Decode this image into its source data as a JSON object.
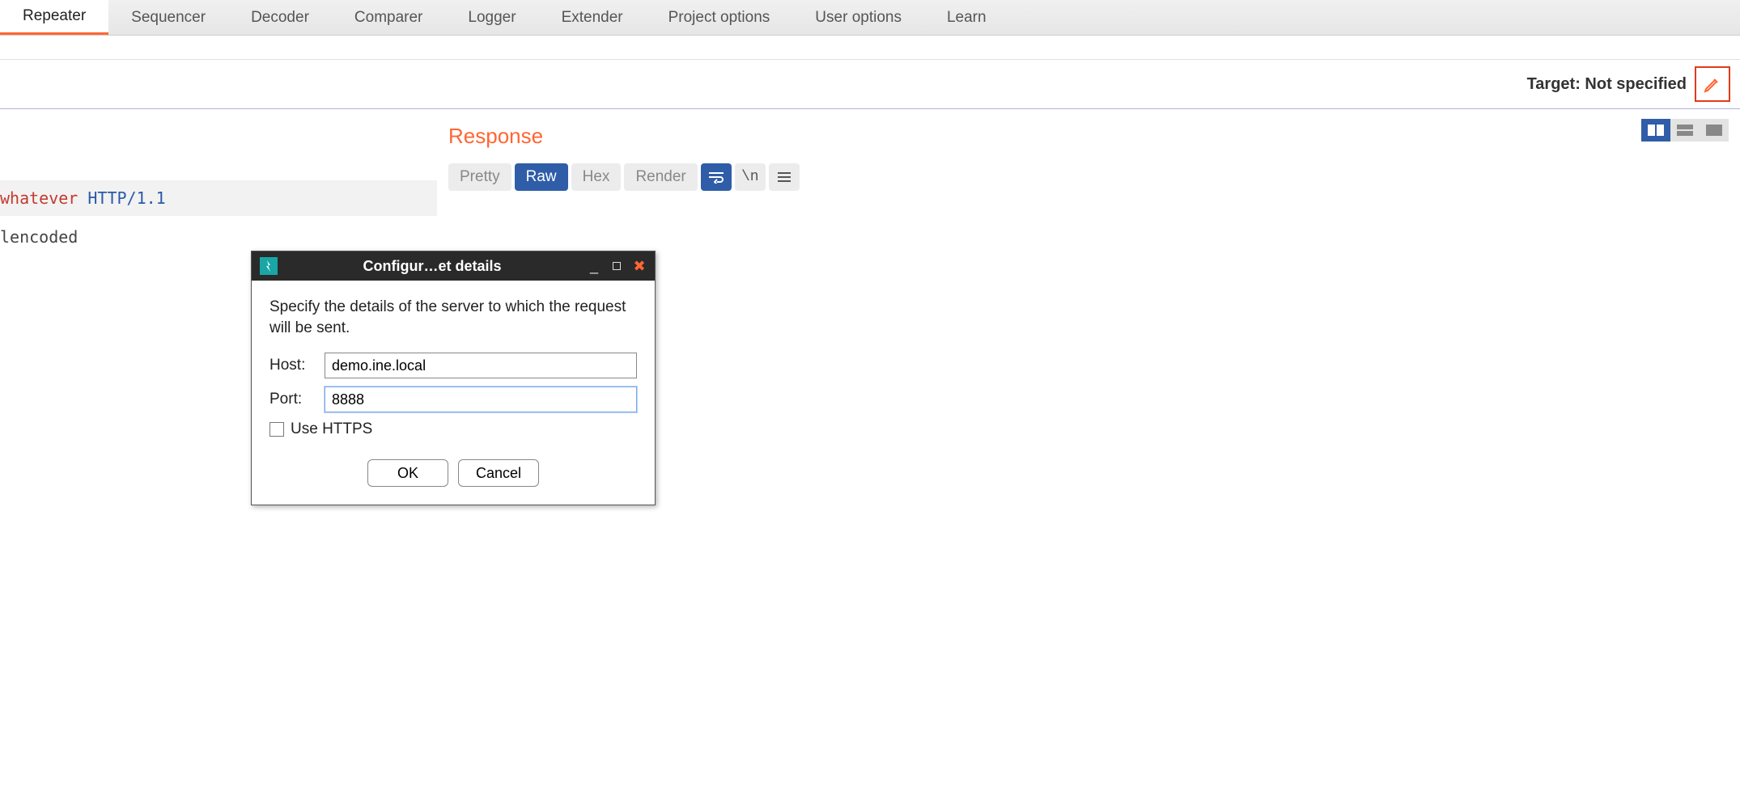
{
  "tabs": [
    "Repeater",
    "Sequencer",
    "Decoder",
    "Comparer",
    "Logger",
    "Extender",
    "Project options",
    "User options",
    "Learn"
  ],
  "active_tab": "Repeater",
  "target": {
    "label": "Target: Not specified"
  },
  "request": {
    "line1_red": "whatever",
    "line1_rest": " HTTP/1.1",
    "line2": "lencoded"
  },
  "response": {
    "heading": "Response",
    "tabs": [
      "Pretty",
      "Raw",
      "Hex",
      "Render"
    ],
    "active": "Raw",
    "icon_newline": "\\n"
  },
  "dialog": {
    "title": "Configur…et details",
    "instructions": "Specify the details of the server to which the request will be sent.",
    "host_label": "Host:",
    "host_value": "demo.ine.local",
    "port_label": "Port:",
    "port_value": "8888",
    "https_label": "Use HTTPS",
    "https_checked": false,
    "ok": "OK",
    "cancel": "Cancel"
  }
}
